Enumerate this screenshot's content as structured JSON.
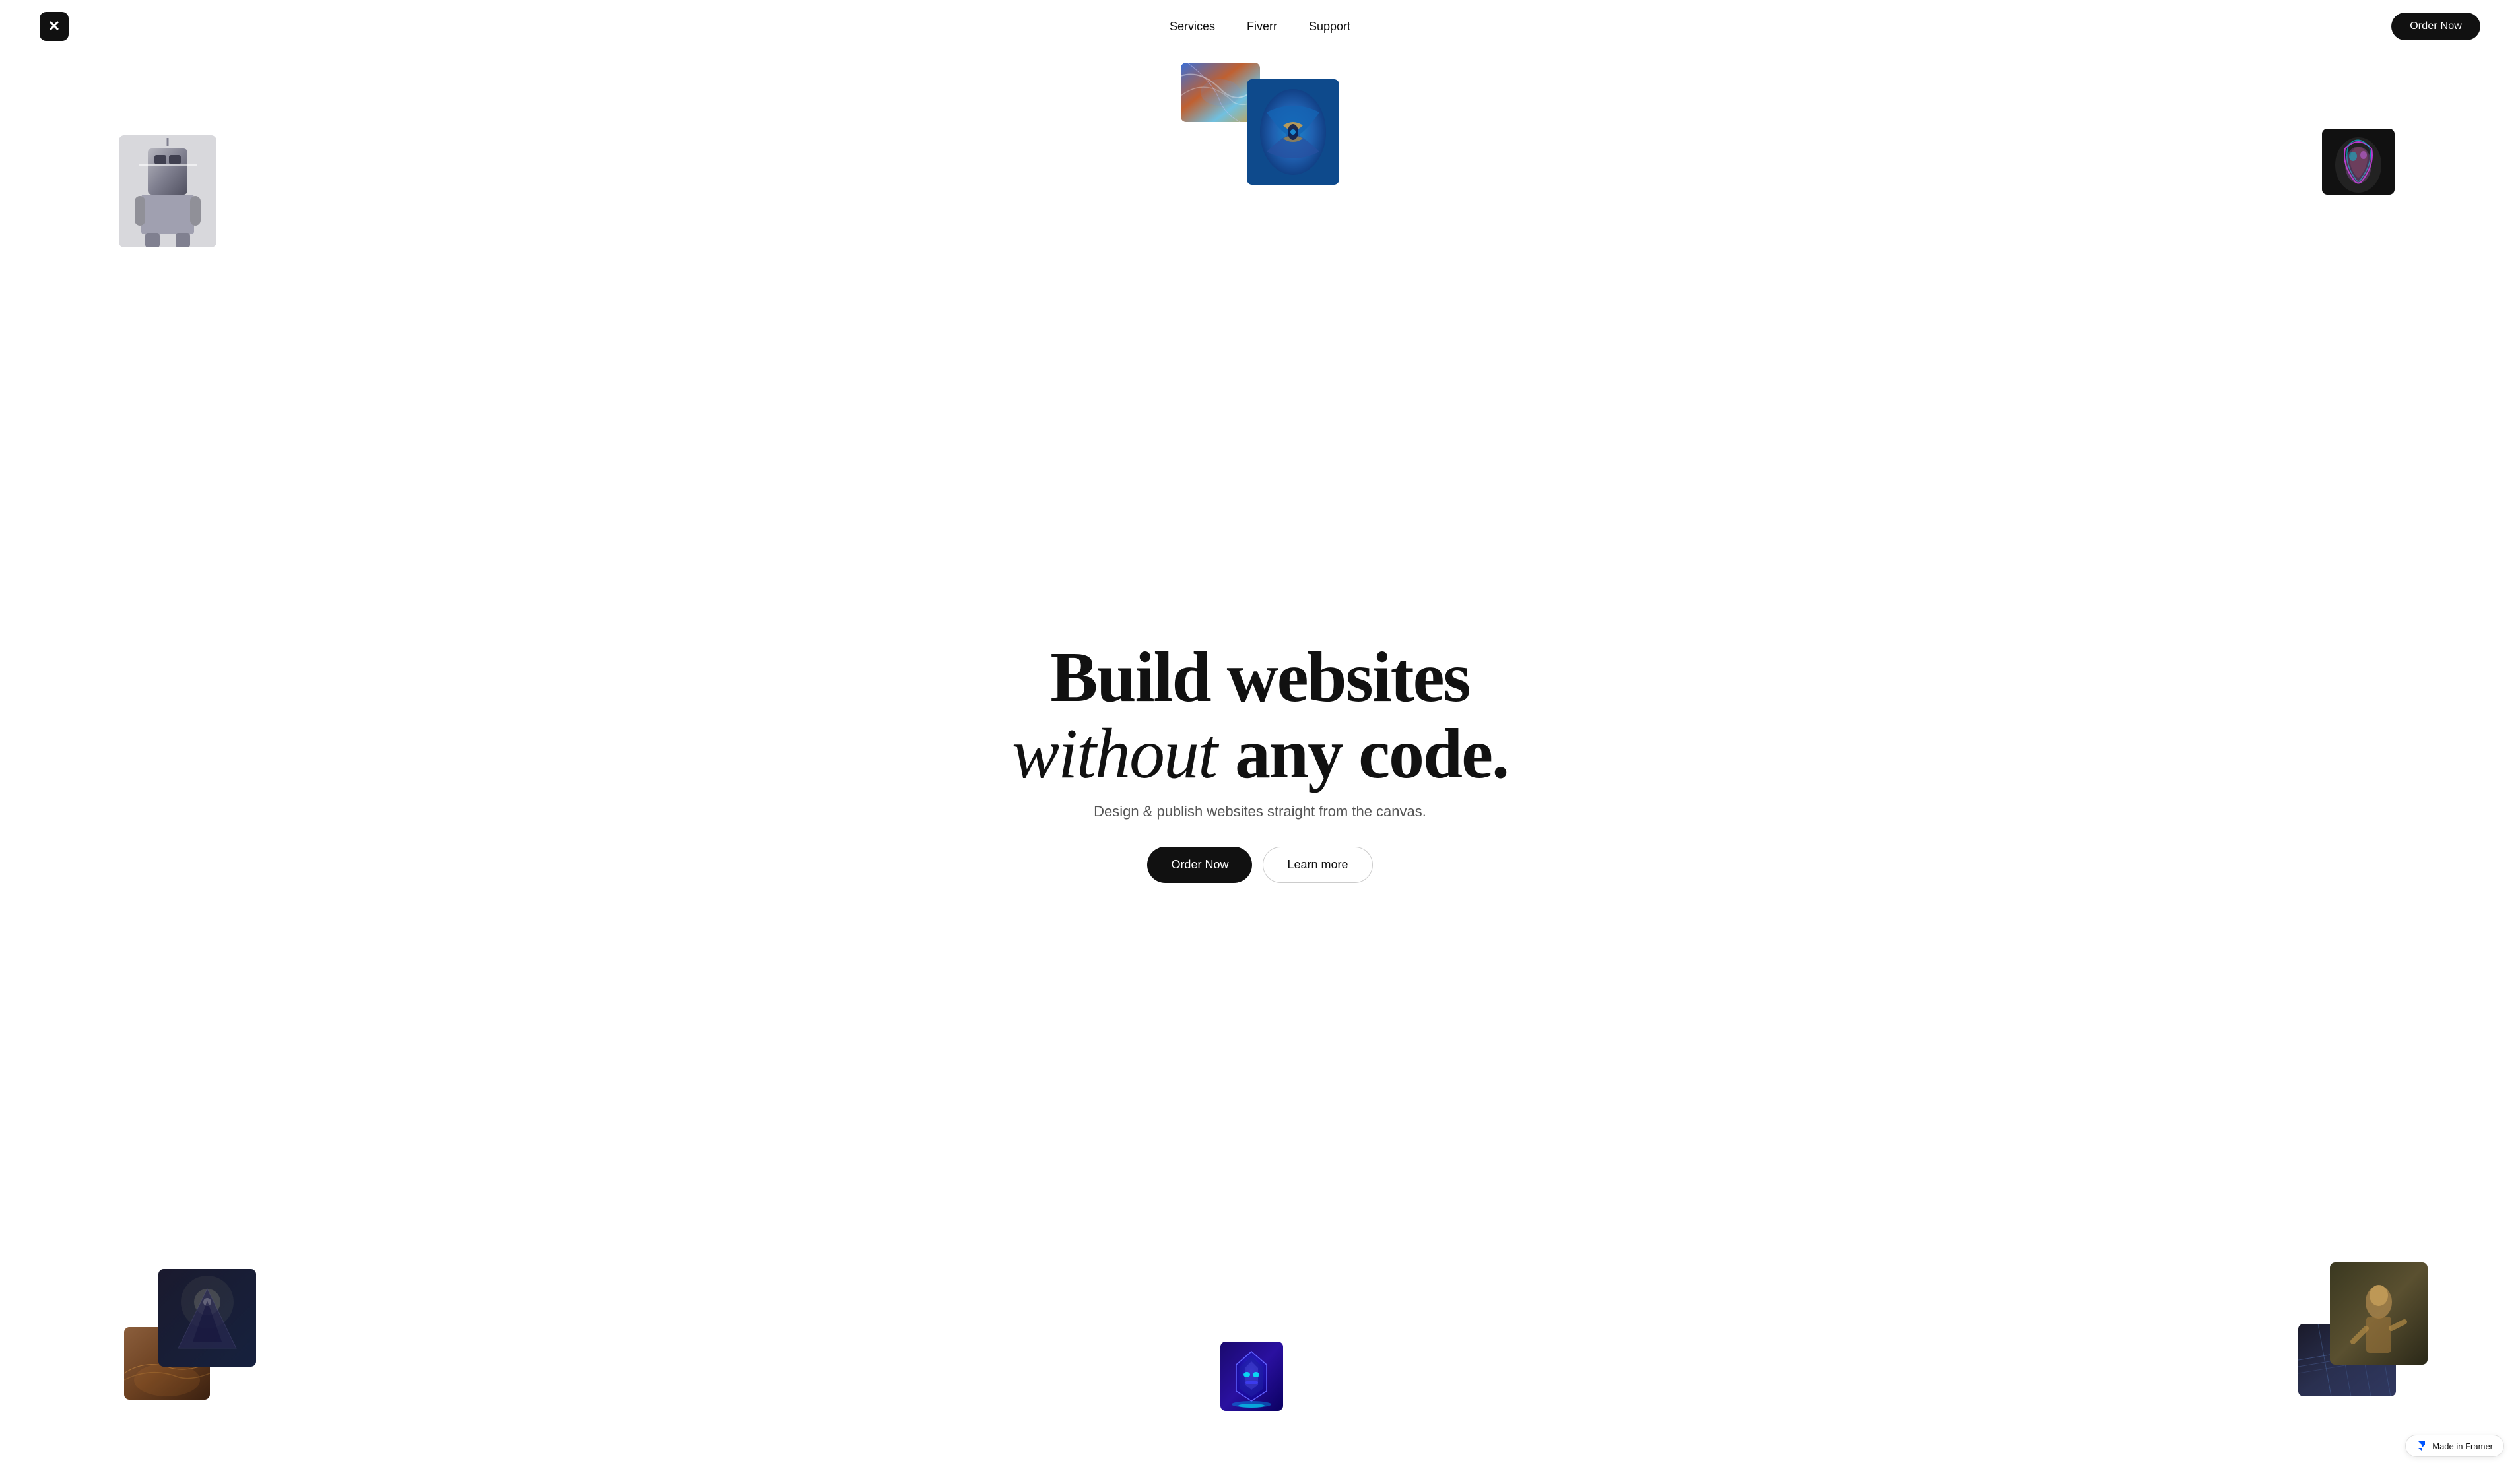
{
  "nav": {
    "logo_text": "𝕏",
    "links": [
      {
        "label": "Services",
        "href": "#"
      },
      {
        "label": "Fiverr",
        "href": "#"
      },
      {
        "label": "Support",
        "href": "#"
      }
    ],
    "cta_label": "Order Now"
  },
  "hero": {
    "title_line1": "Build websites",
    "title_line2_italic": "without",
    "title_line2_normal": "any code.",
    "subtitle": "Design & publish websites straight from the canvas.",
    "btn_primary": "Order Now",
    "btn_secondary": "Learn more"
  },
  "framer_badge": {
    "label": "Made in Framer"
  },
  "colors": {
    "bg": "#ffffff",
    "text": "#111111",
    "nav_cta_bg": "#111111",
    "nav_cta_text": "#ffffff"
  }
}
